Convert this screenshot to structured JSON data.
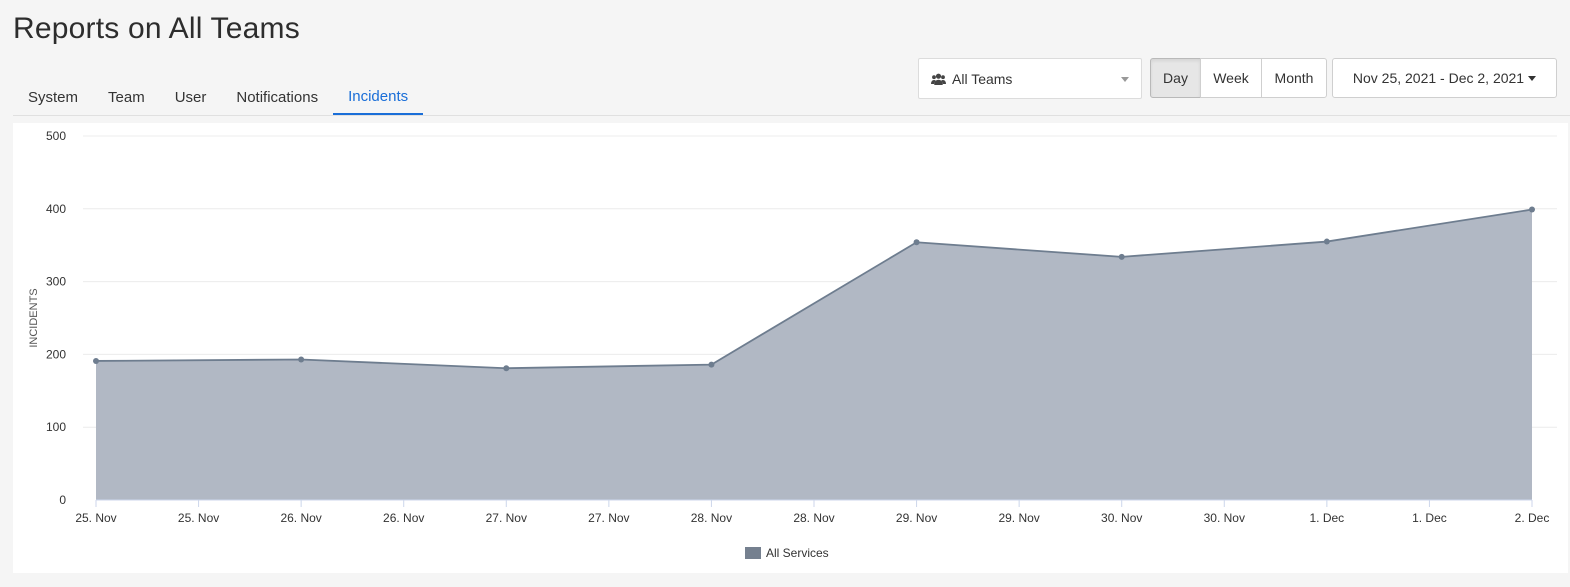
{
  "page": {
    "title": "Reports on All Teams"
  },
  "tabs": [
    {
      "label": "System",
      "active": false
    },
    {
      "label": "Team",
      "active": false
    },
    {
      "label": "User",
      "active": false
    },
    {
      "label": "Notifications",
      "active": false
    },
    {
      "label": "Incidents",
      "active": true
    }
  ],
  "filters": {
    "team_select": {
      "value": "All Teams",
      "icon": "users-icon"
    },
    "granularity": [
      {
        "label": "Day",
        "active": true
      },
      {
        "label": "Week",
        "active": false
      },
      {
        "label": "Month",
        "active": false
      }
    ],
    "date_range": "Nov 25, 2021 - Dec 2, 2021"
  },
  "colors": {
    "accent": "#1a6ed8",
    "series_fill": "#b1b8c4",
    "series_line": "#6e7d8f",
    "legend_swatch": "#75808f"
  },
  "chart_data": {
    "type": "area",
    "ylabel": "INCIDENTS",
    "ylim": [
      0,
      500
    ],
    "yticks": [
      0,
      100,
      200,
      300,
      400,
      500
    ],
    "x_tick_labels": [
      "25. Nov",
      "25. Nov",
      "26. Nov",
      "26. Nov",
      "27. Nov",
      "27. Nov",
      "28. Nov",
      "28. Nov",
      "29. Nov",
      "29. Nov",
      "30. Nov",
      "30. Nov",
      "1. Dec",
      "1. Dec",
      "2. Dec"
    ],
    "series": [
      {
        "name": "All Services",
        "x": [
          "2021-11-25",
          "2021-11-26",
          "2021-11-27",
          "2021-11-28",
          "2021-11-29",
          "2021-11-30",
          "2021-12-01",
          "2021-12-02"
        ],
        "values": [
          191,
          193,
          181,
          186,
          354,
          334,
          355,
          399
        ]
      }
    ],
    "grid": true,
    "legend": "bottom-center"
  }
}
